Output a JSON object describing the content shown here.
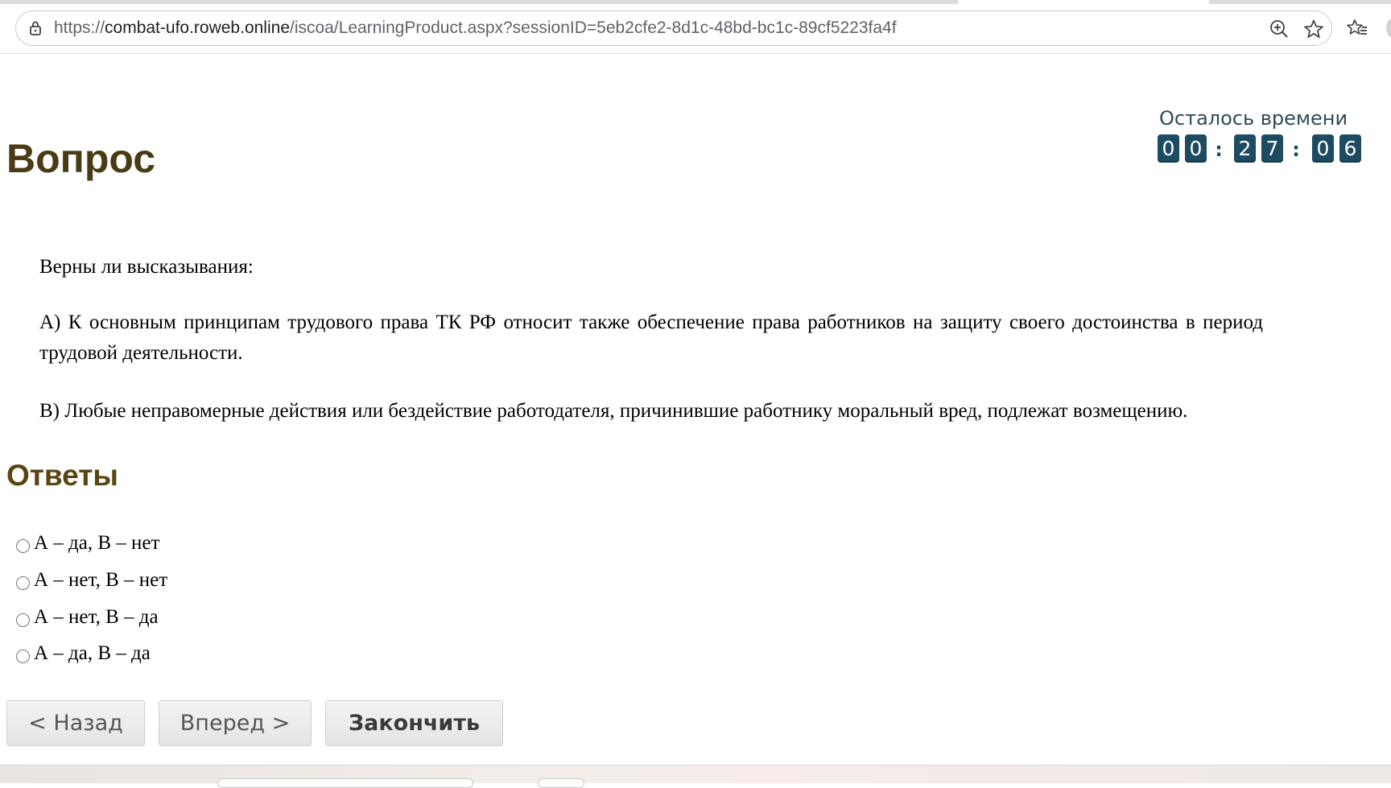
{
  "browser": {
    "url_prefix": "https://",
    "url_host": "combat-ufo.roweb.online",
    "url_path": "/iscoa/LearningProduct.aspx?sessionID=5eb2cfe2-8d1c-48bd-bc1c-89cf5223fa4f",
    "icons": [
      "lock-icon",
      "zoom-icon",
      "star-icon",
      "favorites-icon"
    ]
  },
  "page": {
    "question_heading": "Вопрос",
    "answers_heading": "Ответы"
  },
  "timer": {
    "label": "Осталось времени",
    "digits": [
      "0",
      "0",
      "2",
      "7",
      "0",
      "6"
    ],
    "separator": ":",
    "digit_color": "#1d4b62"
  },
  "question": {
    "intro": "Верны ли высказывания:",
    "statement_a": "А) К основным принципам трудового права ТК РФ относит также обеспечение права работников на защиту своего достоинства в период трудовой деятельности.",
    "statement_b": "В) Любые неправомерные действия или бездействие работодателя, причинившие работнику моральный вред, подлежат возмещению."
  },
  "answers": [
    {
      "label": "А – да, В – нет",
      "selected": false
    },
    {
      "label": "А – нет, В – нет",
      "selected": false
    },
    {
      "label": "А – нет, В – да",
      "selected": false
    },
    {
      "label": "А – да, В – да",
      "selected": false
    }
  ],
  "buttons": {
    "back": "< Назад",
    "forward": "Вперед >",
    "finish": "Закончить"
  }
}
